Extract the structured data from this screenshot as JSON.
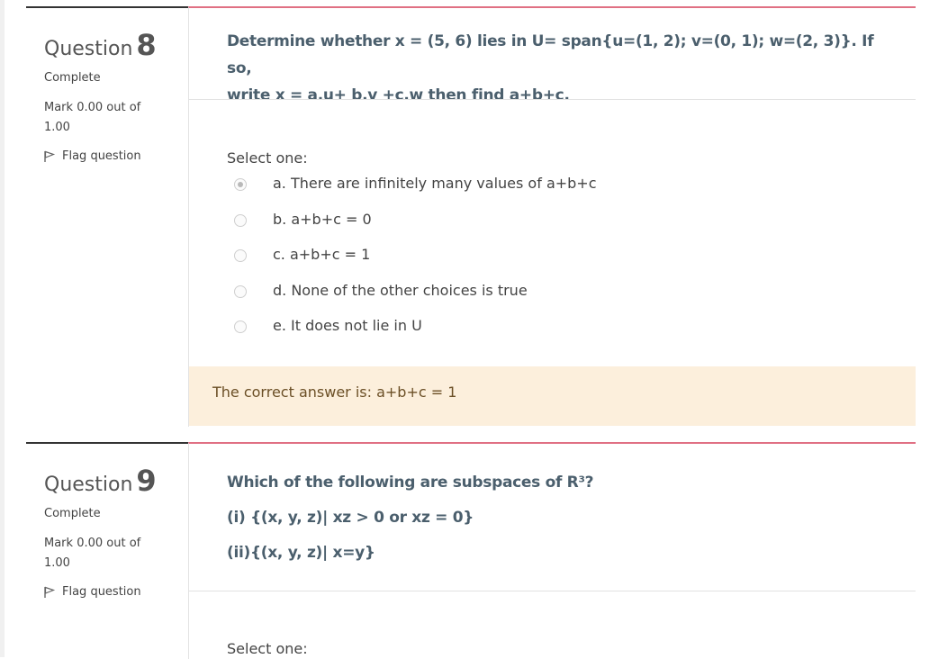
{
  "q8": {
    "label": "Question",
    "number": "8",
    "state": "Complete",
    "grade": "Mark 0.00 out of 1.00",
    "flag": "Flag question",
    "text_line1": "Determine whether x = (5, 6) lies in U= span{u=(1, 2); v=(0, 1); w=(2, 3)}. If so,",
    "text_line2": "write x = a.u+ b.v +c.w then find a+b+c.",
    "prompt": "Select one:",
    "answers": [
      {
        "label": "a. There are infinitely many values of a+b+c",
        "selected": true
      },
      {
        "label": "b. a+b+c = 0",
        "selected": false
      },
      {
        "label": "c. a+b+c = 1",
        "selected": false
      },
      {
        "label": "d. None of the other choices is true",
        "selected": false
      },
      {
        "label": "e. It does not lie in U",
        "selected": false
      }
    ],
    "feedback": "The correct answer is: a+b+c = 1"
  },
  "q9": {
    "label": "Question",
    "number": "9",
    "state": "Complete",
    "grade": "Mark 0.00 out of 1.00",
    "flag": "Flag question",
    "text_line1": "Which of the following are subspaces of R³?",
    "text_line2": "(i) {(x, y, z)| xz > 0 or xz = 0}",
    "text_line3": "(ii){(x, y, z)| x=y}",
    "prompt": "Select one:"
  }
}
